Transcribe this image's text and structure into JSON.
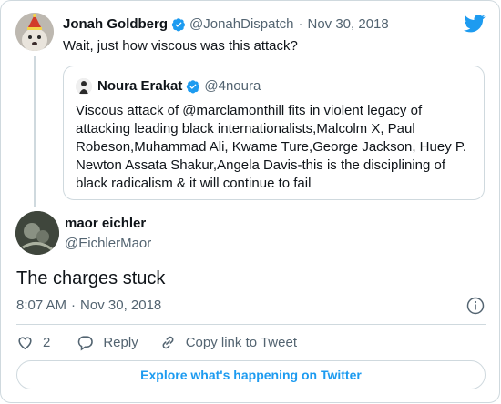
{
  "colors": {
    "accent": "#1d9bf0",
    "text": "#0f1419",
    "muted": "#536471",
    "border": "#cfd9de"
  },
  "tweet": {
    "author_name": "Jonah Goldberg",
    "author_handle": "@JonahDispatch",
    "separator": "·",
    "date": "Nov 30, 2018",
    "text": "Wait, just how viscous was this attack?"
  },
  "quoted": {
    "author_name": "Noura Erakat",
    "author_handle": "@4noura",
    "text": "Viscous attack of @marclamonthill fits in violent legacy of attacking leading black internationalists,Malcolm X, Paul Robeson,Muhammad Ali, Kwame Ture,George Jackson, Huey P. Newton Assata Shakur,Angela Davis-this is the disciplining of black radicalism & it will continue to fail"
  },
  "reply": {
    "author_name": "maor eichler",
    "author_handle": "@EichlerMaor",
    "text": "The charges stuck",
    "time": "8:07 AM",
    "separator": "·",
    "date": "Nov 30, 2018"
  },
  "actions": {
    "like_count": "2",
    "reply_label": "Reply",
    "copy_label": "Copy link to Tweet"
  },
  "explore_label": "Explore what's happening on Twitter",
  "icons": [
    "twitter-bird-icon",
    "verified-badge-icon",
    "info-icon",
    "heart-icon",
    "reply-bubble-icon",
    "link-icon"
  ]
}
